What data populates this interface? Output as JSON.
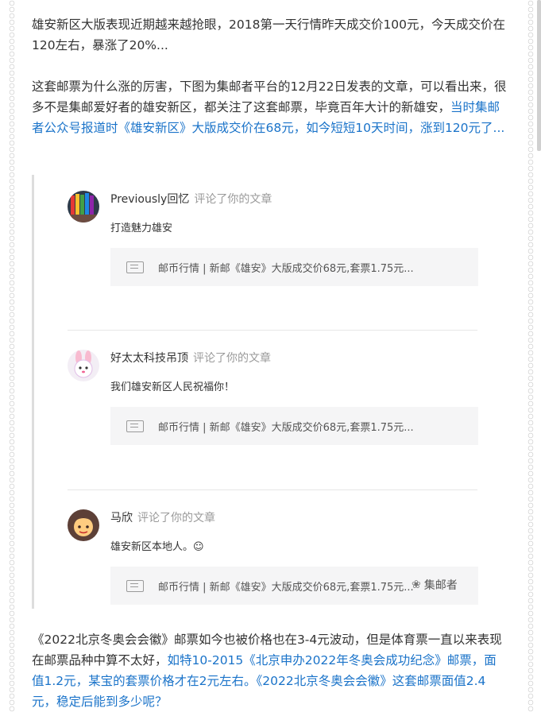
{
  "article": {
    "para1": "雄安新区大版表现近期越来越抢眼，2018第一天行情昨天成交价100元，今天成交价在120左右，暴涨了20%...",
    "para2_black": "这套邮票为什么涨的厉害，下图为集邮者平台的12月22日发表的文章，可以看出来，很多不是集邮爱好者的雄安新区，都关注了这套邮票，毕竟百年大计的新雄安，",
    "para2_blue": "当时集邮者公众号报道时《雄安新区》大版成交价在68元，如今短短10天时间，涨到120元了...",
    "para3_black": "《2022北京冬奥会会徽》邮票如今也被价格也在3-4元波动，但是体育票一直以来表现在邮票品种中算不太好，",
    "para3_blue": "如特10-2015《北京申办2022年冬奥会成功纪念》邮票，面值1.2元，某宝的套票价格才在2元左右。《2022北京冬奥会会徽》这套邮票面值2.4元，稳定后能到多少呢？"
  },
  "comments": [
    {
      "user": "Previously回忆",
      "action": "评论了你的文章",
      "text": "打造魅力雄安",
      "link_title": "邮币行情 | 新邮《雄安》大版成交价68元,套票1.75元..."
    },
    {
      "user": "好太太科技吊顶",
      "action": "评论了你的文章",
      "text": "我们雄安新区人民祝福你！",
      "link_title": "邮币行情 | 新邮《雄安》大版成交价68元,套票1.75元..."
    },
    {
      "user": "马欣",
      "action": "评论了你的文章",
      "text": "雄安新区本地人。☺",
      "link_title": "邮币行情 | 新邮《雄安》大版成交价68元,套票1.75元..."
    }
  ],
  "watermark": {
    "icon": "wechat-icon",
    "label": "集邮者"
  },
  "icons": {
    "link": "document-icon"
  },
  "colors": {
    "link_blue": "#1a73c9",
    "text": "#333333",
    "muted": "#9a9a9a",
    "card_bg": "#f5f5f6"
  }
}
